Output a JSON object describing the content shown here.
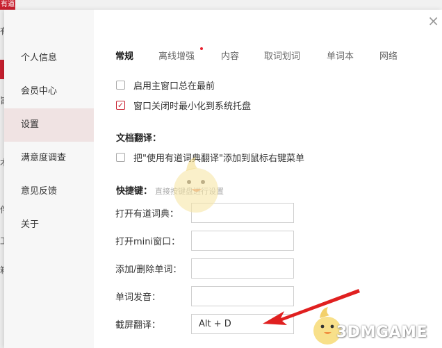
{
  "background": {
    "logo_text": "有道",
    "side_fragments": [
      "有",
      " ",
      "旨",
      "木",
      " ",
      "件",
      "工",
      "箱",
      " "
    ]
  },
  "close_icon": "close-icon",
  "sidebar": {
    "items": [
      {
        "label": "个人信息"
      },
      {
        "label": "会员中心"
      },
      {
        "label": "设置",
        "active": true
      },
      {
        "label": "满意度调查"
      },
      {
        "label": "意见反馈"
      },
      {
        "label": "关于"
      }
    ]
  },
  "tabs": [
    {
      "label": "常规",
      "active": true
    },
    {
      "label": "离线增强",
      "has_dot": true
    },
    {
      "label": "内容"
    },
    {
      "label": "取词划词"
    },
    {
      "label": "单词本"
    },
    {
      "label": "网络"
    }
  ],
  "general": {
    "always_on_top": {
      "label": "启用主窗口总在最前",
      "checked": false
    },
    "minimize_to_tray": {
      "label": "窗口关闭时最小化到系统托盘",
      "checked": true
    }
  },
  "doc_translate": {
    "title": "文档翻译：",
    "context_menu": {
      "label": "把\"使用有道词典翻译\"添加到鼠标右键菜单",
      "checked": false
    }
  },
  "shortcuts": {
    "title": "快捷键：",
    "hint": "直接按键盘进行设置",
    "items": [
      {
        "label": "打开有道词典：",
        "value": ""
      },
      {
        "label": "打开mini窗口：",
        "value": ""
      },
      {
        "label": "添加/删除单词：",
        "value": ""
      },
      {
        "label": "单词发音：",
        "value": ""
      },
      {
        "label": "截屏翻译：",
        "value": "Alt + D"
      }
    ]
  },
  "watermark": "3DMGAME",
  "colors": {
    "accent": "#c8202f",
    "active_nav_bg": "#f0e3e3",
    "arrow": "#e02020"
  }
}
